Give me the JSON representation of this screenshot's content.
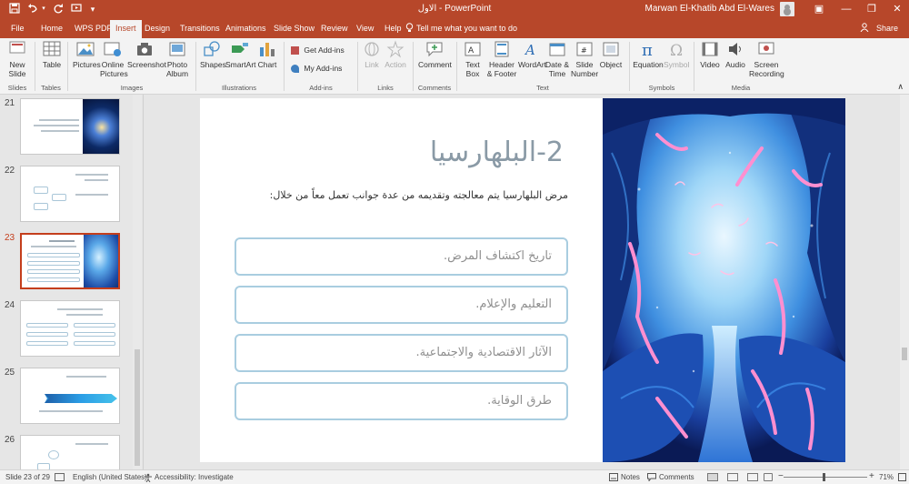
{
  "titlebar": {
    "title": "الاول  -  PowerPoint",
    "user": "Marwan El-Khatib Abd El-Wares",
    "save_icon": "save-icon",
    "undo_icon": "undo-icon",
    "redo_icon": "redo-icon",
    "present_icon": "present-from-beginning-icon",
    "minimize_glyph": "—",
    "restore_glyph": "❐",
    "close_glyph": "✕",
    "ribbon_display_glyph": "▣"
  },
  "tabs": [
    "File",
    "Home",
    "WPS PDF",
    "Insert",
    "Design",
    "Transitions",
    "Animations",
    "Slide Show",
    "Review",
    "View",
    "Help"
  ],
  "active_tab": "Insert",
  "tell_me": "Tell me what you want to do",
  "share": "Share",
  "ribbon": {
    "new_slide": "New\nSlide",
    "table": "Table",
    "pictures": "Pictures",
    "online_pictures": "Online\nPictures",
    "screenshot": "Screenshot",
    "photo_album": "Photo\nAlbum",
    "shapes": "Shapes",
    "smartart": "SmartArt",
    "chart": "Chart",
    "get_addins": "Get Add-ins",
    "my_addins": "My Add-ins",
    "link": "Link",
    "action": "Action",
    "comment": "Comment",
    "text_box": "Text\nBox",
    "header_footer": "Header\n& Footer",
    "wordart": "WordArt",
    "date_time": "Date &\nTime",
    "slide_number": "Slide\nNumber",
    "object": "Object",
    "equation": "Equation",
    "symbol": "Symbol",
    "video": "Video",
    "audio": "Audio",
    "screen_recording": "Screen\nRecording",
    "groups": [
      "Slides",
      "Tables",
      "Images",
      "Illustrations",
      "Add-ins",
      "Links",
      "Comments",
      "Text",
      "Symbols",
      "Media"
    ]
  },
  "thumbnails": [
    {
      "num": "21",
      "selected": false
    },
    {
      "num": "22",
      "selected": false
    },
    {
      "num": "23",
      "selected": true
    },
    {
      "num": "24",
      "selected": false
    },
    {
      "num": "25",
      "selected": false
    },
    {
      "num": "26",
      "selected": false
    }
  ],
  "slide": {
    "title": "2-البلهارسيا",
    "body": "مرض البلهارسيا يتم معالجته وتقديمه من عدة جوانب تعمل معاً من خلال:",
    "boxes": [
      "تاريخ اكتشاف المرض.",
      "التعليم والإعلام.",
      "الآثار الاقتصادية والاجتماعية.",
      "طرق الوقاية."
    ]
  },
  "status": {
    "slide_count": "Slide 23 of 29",
    "language": "English (United States)",
    "accessibility": "Accessibility: Investigate",
    "notes": "Notes",
    "comments": "Comments",
    "zoom": "71%"
  },
  "colors": {
    "accent": "#b7472a",
    "box_border": "#a9cde0",
    "title_color": "#8a9aa6"
  }
}
